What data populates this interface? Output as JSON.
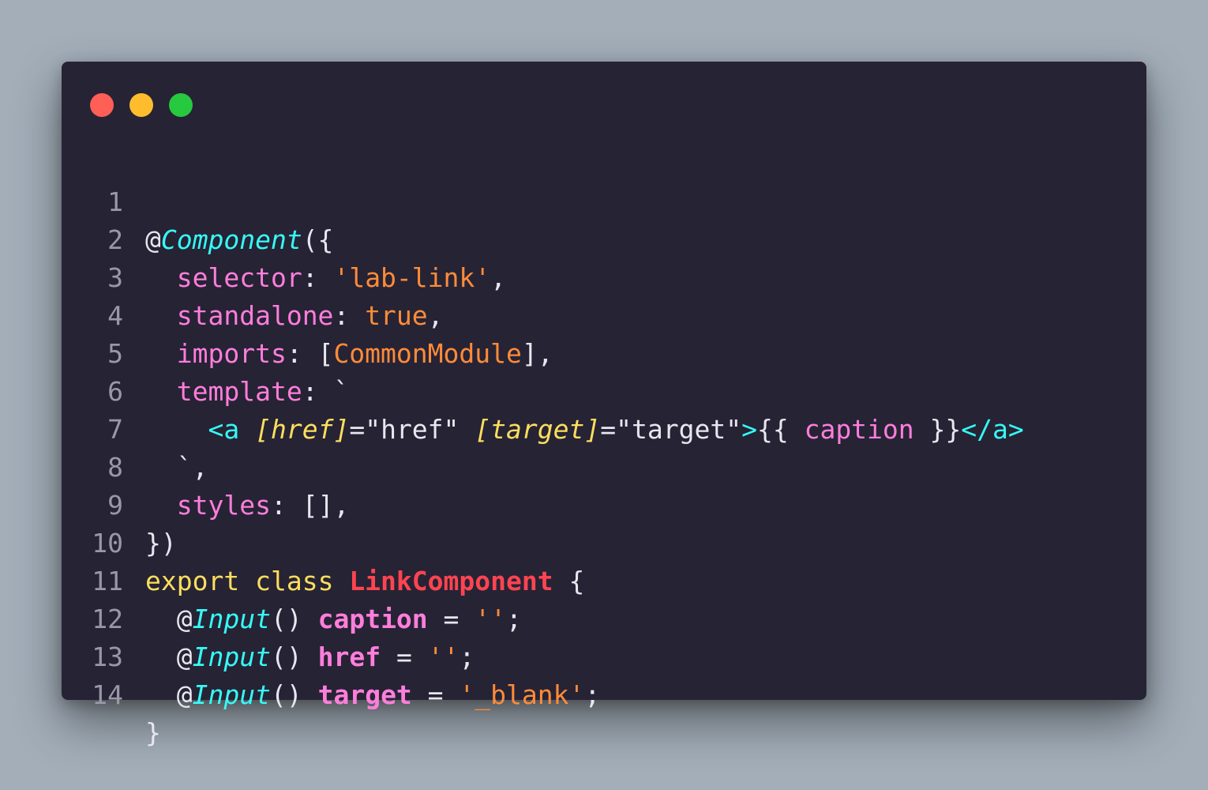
{
  "window": {
    "controls": [
      "close",
      "minimize",
      "maximize"
    ],
    "colors": {
      "close": "#ff5f56",
      "minimize": "#ffbd2e",
      "maximize": "#27c93f",
      "background": "#262335"
    }
  },
  "code": {
    "line_numbers": [
      "1",
      "2",
      "3",
      "4",
      "5",
      "6",
      "7",
      "8",
      "9",
      "10",
      "11",
      "12",
      "13",
      "14"
    ],
    "l1": {
      "at": "@",
      "deco": "Component",
      "rest": "({"
    },
    "l2": {
      "prop": "selector",
      "colon": ": ",
      "str": "'lab-link'",
      "end": ","
    },
    "l3": {
      "prop": "standalone",
      "colon": ": ",
      "val": "true",
      "end": ","
    },
    "l4": {
      "prop": "imports",
      "colon": ": [",
      "val": "CommonModule",
      "end": "],"
    },
    "l5": {
      "prop": "template",
      "colon": ": ",
      "tick": "`"
    },
    "l6": {
      "open": "<a",
      "a1": "[href]",
      "eq1": "=",
      "v1": "\"href\"",
      "a2": "[target]",
      "eq2": "=",
      "v2": "\"target\"",
      "gt": ">",
      "io": "{{",
      "expr": "caption",
      "ic": "}}",
      "close": "</a>"
    },
    "l7": {
      "text": "`,"
    },
    "l8": {
      "prop": "styles",
      "rest": ": [],"
    },
    "l9": {
      "text": "})"
    },
    "l10": {
      "kw1": "export",
      "kw2": "class",
      "cls": "LinkComponent",
      "brace": "{"
    },
    "l11": {
      "at": "@",
      "deco": "Input",
      "paren": "()",
      "field": "caption",
      "eq": " = ",
      "str": "''",
      "end": ";"
    },
    "l12": {
      "at": "@",
      "deco": "Input",
      "paren": "()",
      "field": "href",
      "eq": " = ",
      "str": "''",
      "end": ";"
    },
    "l13": {
      "at": "@",
      "deco": "Input",
      "paren": "()",
      "field": "target",
      "eq": " = ",
      "str": "'_blank'",
      "end": ";"
    },
    "l14": {
      "text": "}"
    }
  }
}
